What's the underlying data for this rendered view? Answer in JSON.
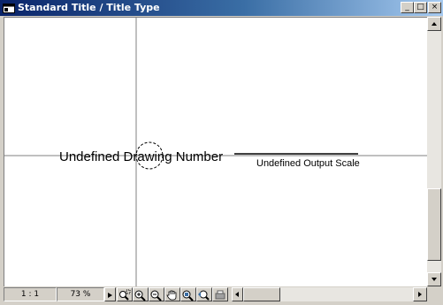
{
  "window": {
    "title": "Standard Title / Title Type",
    "controls": {
      "minimize": "_",
      "maximize": "□",
      "close": "×"
    }
  },
  "canvas": {
    "drawing_number_text": "Undefined Drawing Number",
    "output_scale_text": "Undefined Output Scale"
  },
  "status": {
    "scale": "1 : 1",
    "zoom": "73 %"
  },
  "toolbar": {
    "icons": [
      "play-icon",
      "zoom-window-icon",
      "zoom-in-icon",
      "zoom-out-icon",
      "pan-hand-icon",
      "zoom-extents-icon",
      "zoom-previous-icon",
      "print-preview-icon"
    ]
  },
  "colors": {
    "title_gradient_start": "#0a246a",
    "title_gradient_end": "#a6caf0",
    "face": "#d4d0c8"
  }
}
